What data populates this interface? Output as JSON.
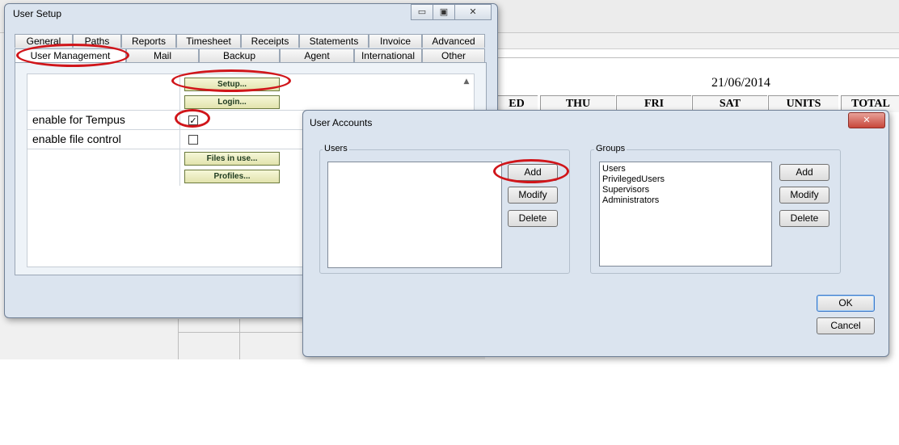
{
  "background": {
    "date": "21/06/2014",
    "columns": [
      "ED",
      "THU",
      "FRI",
      "SAT",
      "UNITS",
      "TOTAL"
    ]
  },
  "user_setup": {
    "title": "User Setup",
    "tabs_row1": [
      "General",
      "Paths",
      "Reports",
      "Timesheet",
      "Receipts",
      "Statements",
      "Invoice",
      "Advanced"
    ],
    "tabs_row2": [
      "User  Management",
      "Mail",
      "Backup",
      "Agent",
      "International",
      "Other"
    ],
    "active_tab": "User  Management",
    "buttons": {
      "setup": "Setup...",
      "login": "Login...",
      "files_in_use": "Files in use...",
      "profiles": "Profiles..."
    },
    "rows": [
      {
        "label": "enable for Tempus",
        "checked": true
      },
      {
        "label": "enable file control",
        "checked": false
      }
    ]
  },
  "user_accounts": {
    "title": "User Accounts",
    "users_group": {
      "label": "Users",
      "items": [],
      "buttons": [
        "Add",
        "Modify",
        "Delete"
      ]
    },
    "groups_group": {
      "label": "Groups",
      "items": [
        "Users",
        "PrivilegedUsers",
        "Supervisors",
        "Administrators"
      ],
      "buttons": [
        "Add",
        "Modify",
        "Delete"
      ]
    },
    "ok": "OK",
    "cancel": "Cancel",
    "close_glyph": "✕"
  },
  "colors": {
    "annotation_red": "#d0151a",
    "dialog_background": "#dbe4ef",
    "yellow_button": "#e2e3ad"
  }
}
